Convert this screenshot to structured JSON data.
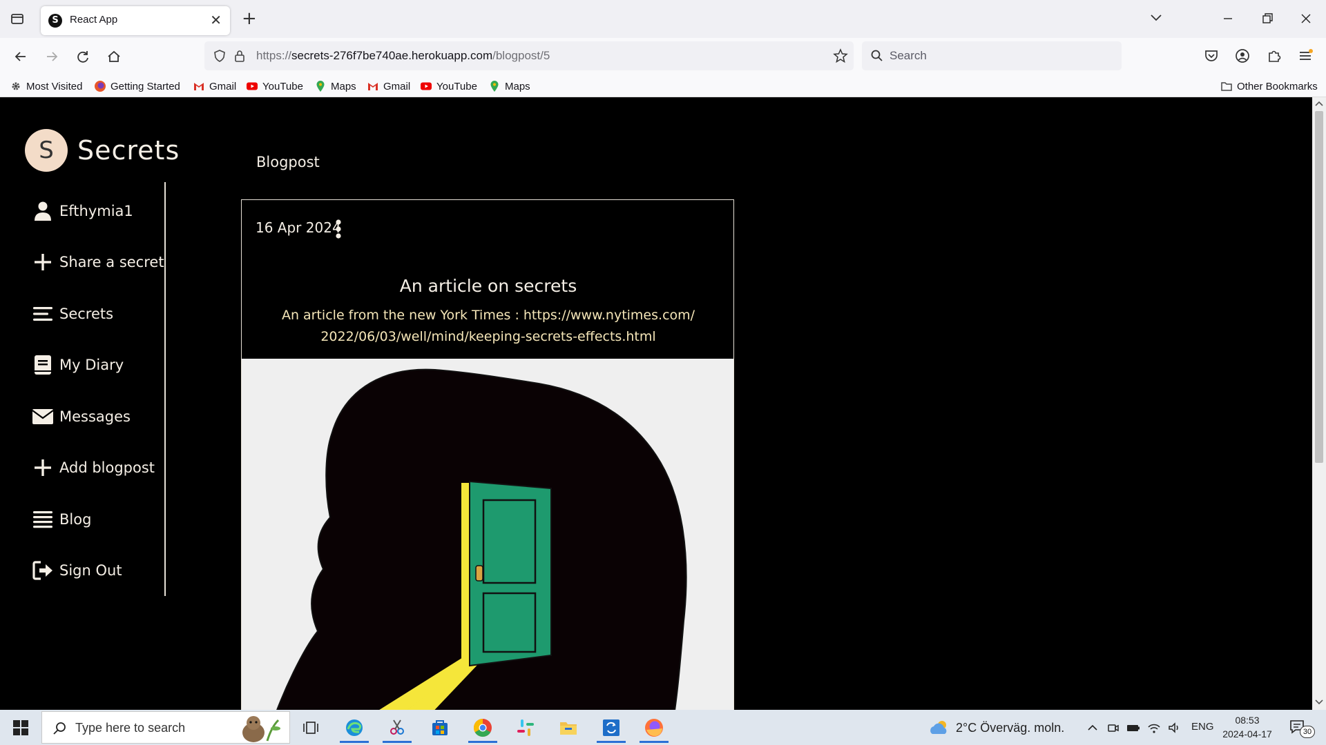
{
  "browser": {
    "tab": {
      "title": "React App",
      "favicon_letter": "S"
    },
    "url": {
      "prefix": "https://",
      "host": "secrets-276f7be740ae.herokuapp.com",
      "path": "/blogpost/5"
    },
    "search_placeholder": "Search",
    "bookmarks": [
      {
        "label": "Most Visited",
        "icon": "gear-icon"
      },
      {
        "label": "Getting Started",
        "icon": "firefox-icon"
      },
      {
        "label": "Gmail",
        "icon": "gmail-icon"
      },
      {
        "label": "YouTube",
        "icon": "youtube-icon"
      },
      {
        "label": "Maps",
        "icon": "maps-icon"
      },
      {
        "label": "Gmail",
        "icon": "gmail-icon"
      },
      {
        "label": "YouTube",
        "icon": "youtube-icon"
      },
      {
        "label": "Maps",
        "icon": "maps-icon"
      }
    ],
    "other_bookmarks": "Other Bookmarks"
  },
  "app": {
    "logo_letter": "S",
    "logo_text": "Secrets",
    "sidebar": [
      {
        "label": "Efthymia1",
        "icon": "user-icon"
      },
      {
        "label": "Share a secret",
        "icon": "plus-icon"
      },
      {
        "label": "Secrets",
        "icon": "menu-icon"
      },
      {
        "label": "My Diary",
        "icon": "book-icon"
      },
      {
        "label": "Messages",
        "icon": "envelope-icon"
      },
      {
        "label": "Add blogpost",
        "icon": "plus-icon"
      },
      {
        "label": "Blog",
        "icon": "list-icon"
      },
      {
        "label": "Sign Out",
        "icon": "sign-out-icon"
      }
    ],
    "section_title": "Blogpost",
    "post": {
      "date": "16 Apr 2024",
      "title": "An article on secrets",
      "body_line1": "An article from the new York Times :  https://www.nytimes.com/",
      "body_line2": "2022/06/03/well/mind/keeping-secrets-effects.html"
    }
  },
  "taskbar": {
    "search_placeholder": "Type here to search",
    "weather": "2°C  Överväg. moln.",
    "language": "ENG",
    "time": "08:53",
    "date": "2024-04-17",
    "notification_count": "30"
  },
  "colors": {
    "page_background": "#000000",
    "text_light": "#f5efe6",
    "door_green": "#1e9a6e",
    "light_yellow": "#f5e63a",
    "logo_circle": "#f3dcc8"
  }
}
